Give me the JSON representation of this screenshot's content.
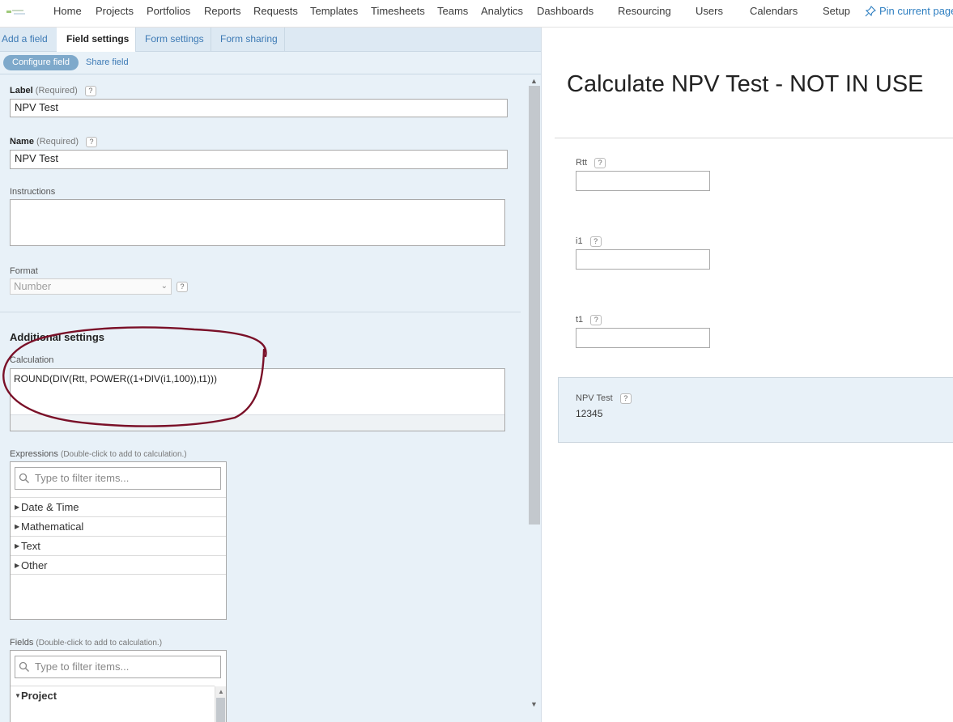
{
  "nav": {
    "items": [
      "Home",
      "Projects",
      "Portfolios",
      "Reports",
      "Requests",
      "Templates",
      "Timesheets",
      "Teams",
      "Analytics",
      "Dashboards",
      "Resourcing",
      "Users",
      "Calendars",
      "Setup"
    ],
    "pin_label": "Pin current page"
  },
  "tabs": [
    "Add a field",
    "Field settings",
    "Form settings",
    "Form sharing"
  ],
  "subtabs": {
    "configure": "Configure field",
    "share": "Share field"
  },
  "field": {
    "label_title": "Label",
    "label_req": "(Required)",
    "label_value": "NPV Test",
    "name_title": "Name",
    "name_req": "(Required)",
    "name_value": "NPV Test",
    "instructions_title": "Instructions",
    "format_title": "Format",
    "format_value": "Number"
  },
  "additional": {
    "heading": "Additional settings",
    "calc_title": "Calculation",
    "calc_value": "ROUND(DIV(Rtt, POWER((1+DIV(i1,100)),t1)))"
  },
  "expressions": {
    "title": "Expressions",
    "hint": "(Double-click to add to calculation.)",
    "placeholder": "Type to filter items...",
    "items": [
      "Date & Time",
      "Mathematical",
      "Text",
      "Other"
    ]
  },
  "fields": {
    "title": "Fields",
    "hint": "(Double-click to add to calculation.)",
    "placeholder": "Type to filter items...",
    "items": [
      "Project"
    ]
  },
  "preview": {
    "title": "Calculate NPV Test - NOT IN USE",
    "inputs": [
      "Rtt",
      "i1",
      "t1"
    ],
    "calc_label": "NPV Test",
    "calc_value": "12345"
  },
  "help_glyph": "?",
  "colors": {
    "link": "#2f7fc1",
    "panel": "#e8f1f8",
    "annotation": "#7a1028"
  }
}
